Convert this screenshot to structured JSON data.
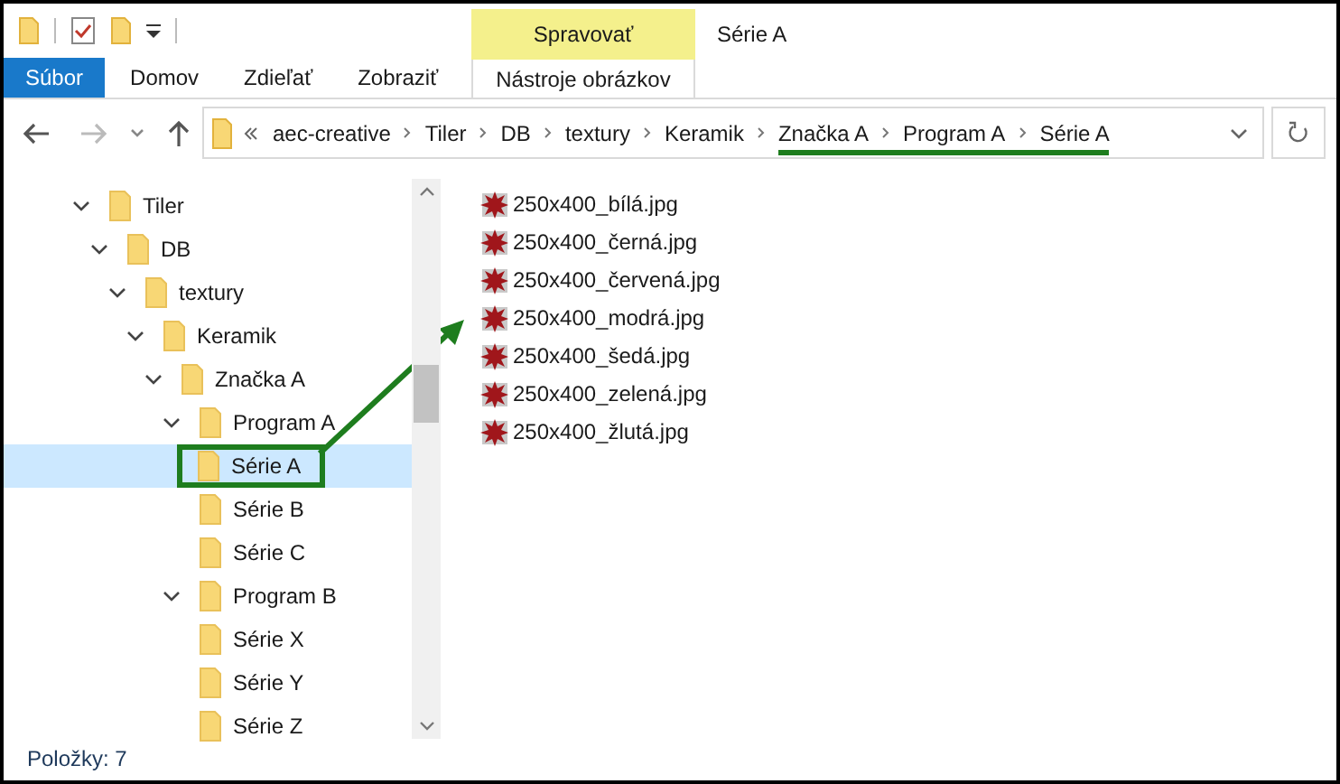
{
  "window": {
    "title": "Série A"
  },
  "ribbon": {
    "context_group": "Spravovať",
    "tabs": [
      {
        "label": "Súbor",
        "kind": "file"
      },
      {
        "label": "Domov",
        "kind": "normal"
      },
      {
        "label": "Zdieľať",
        "kind": "normal"
      },
      {
        "label": "Zobraziť",
        "kind": "normal"
      },
      {
        "label": "Nástroje obrázkov",
        "kind": "context"
      }
    ]
  },
  "address": {
    "crumbs": [
      "aec-creative",
      "Tiler",
      "DB",
      "textury",
      "Keramik",
      "Značka A",
      "Program A",
      "Série A"
    ]
  },
  "tree": [
    {
      "label": "Tiler",
      "expanded": true,
      "selected": false,
      "children": [
        {
          "label": "DB",
          "expanded": true,
          "selected": false,
          "children": [
            {
              "label": "textury",
              "expanded": true,
              "selected": false,
              "children": [
                {
                  "label": "Keramik",
                  "expanded": true,
                  "selected": false,
                  "children": [
                    {
                      "label": "Značka A",
                      "expanded": true,
                      "selected": false,
                      "children": [
                        {
                          "label": "Program A",
                          "expanded": true,
                          "selected": false,
                          "children": [
                            {
                              "label": "Série A",
                              "selected": true
                            },
                            {
                              "label": "Série B",
                              "selected": false
                            },
                            {
                              "label": "Série C",
                              "selected": false
                            }
                          ]
                        },
                        {
                          "label": "Program B",
                          "expanded": true,
                          "selected": false,
                          "children": [
                            {
                              "label": "Série X",
                              "selected": false
                            },
                            {
                              "label": "Série Y",
                              "selected": false
                            },
                            {
                              "label": "Série Z",
                              "selected": false
                            }
                          ]
                        }
                      ]
                    }
                  ]
                }
              ]
            }
          ]
        }
      ]
    }
  ],
  "files": [
    {
      "name": "250x400_bílá.jpg"
    },
    {
      "name": "250x400_černá.jpg"
    },
    {
      "name": "250x400_červená.jpg"
    },
    {
      "name": "250x400_modrá.jpg"
    },
    {
      "name": "250x400_šedá.jpg"
    },
    {
      "name": "250x400_zelená.jpg"
    },
    {
      "name": "250x400_žlutá.jpg"
    }
  ],
  "status_bar": "Položky: 7"
}
